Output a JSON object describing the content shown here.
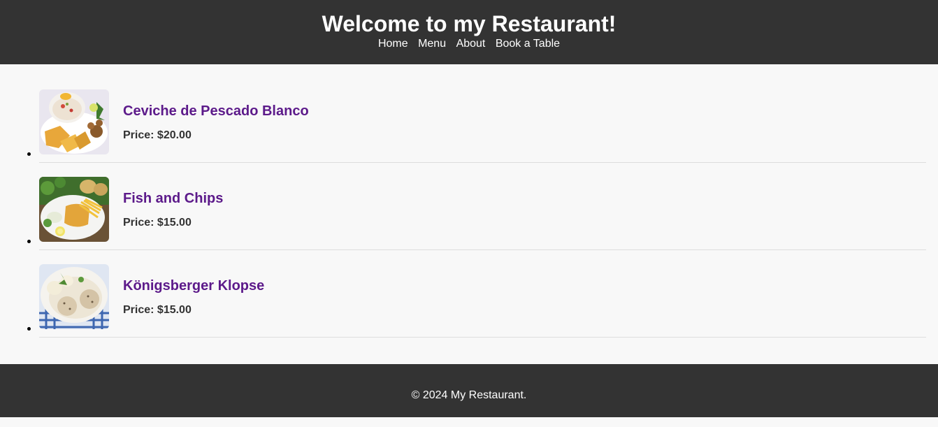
{
  "header": {
    "title": "Welcome to my Restaurant!",
    "nav": [
      "Home",
      "Menu",
      "About",
      "Book a Table"
    ]
  },
  "menu": {
    "items": [
      {
        "name": "Ceviche de Pescado Blanco",
        "price": "Price: $20.00",
        "image": "ceviche-photo"
      },
      {
        "name": "Fish and Chips",
        "price": "Price: $15.00",
        "image": "fish-and-chips-photo"
      },
      {
        "name": "Königsberger Klopse",
        "price": "Price: $15.00",
        "image": "koenigsberger-klopse-photo"
      }
    ]
  },
  "footer": {
    "text": "© 2024 My Restaurant."
  },
  "colors": {
    "header_bg": "#333333",
    "page_bg": "#f8f8f8",
    "item_name": "#5c1a8a",
    "divider": "#dddddd"
  }
}
